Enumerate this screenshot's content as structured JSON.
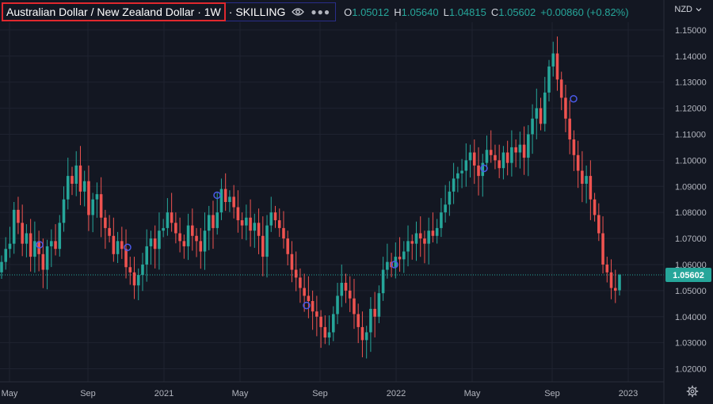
{
  "header": {
    "title": "Australian Dollar / New Zealand Dollar · 1W",
    "broker": "· SKILLING",
    "ohlc": [
      {
        "k": "O",
        "v": "1.05012"
      },
      {
        "k": "H",
        "v": "1.05640"
      },
      {
        "k": "L",
        "v": "1.04815"
      },
      {
        "k": "C",
        "v": "1.05602"
      },
      {
        "k": "",
        "v": "+0.00860 (+0.82%)"
      }
    ],
    "currency": "NZD"
  },
  "colors": {
    "background": "#131722",
    "up": "#26a69a",
    "down": "#ef5350",
    "grid": "#1f2330",
    "text": "#b2b5be",
    "title_border": "#e0282e",
    "price_badge": "#26a69a"
  },
  "chart_data": {
    "type": "candlestick",
    "title": "Australian Dollar / New Zealand Dollar · 1W",
    "ylim": [
      1.015,
      1.153
    ],
    "yticks": [
      "1.15000",
      "1.14000",
      "1.13000",
      "1.12000",
      "1.11000",
      "1.10000",
      "1.09000",
      "1.08000",
      "1.07000",
      "1.06000",
      "1.05000",
      "1.04000",
      "1.03000",
      "1.02000"
    ],
    "xticks": [
      "May",
      "Sep",
      "2021",
      "May",
      "Sep",
      "2022",
      "May",
      "Sep",
      "2023"
    ],
    "last_price": "1.05602",
    "closes": [
      1.061,
      1.066,
      1.068,
      1.081,
      1.076,
      1.068,
      1.072,
      1.063,
      1.069,
      1.064,
      1.058,
      1.067,
      1.069,
      1.066,
      1.076,
      1.085,
      1.094,
      1.091,
      1.098,
      1.088,
      1.092,
      1.079,
      1.085,
      1.087,
      1.078,
      1.074,
      1.071,
      1.064,
      1.069,
      1.066,
      1.059,
      1.057,
      1.052,
      1.056,
      1.06,
      1.067,
      1.07,
      1.066,
      1.073,
      1.074,
      1.08,
      1.076,
      1.072,
      1.069,
      1.067,
      1.075,
      1.071,
      1.069,
      1.065,
      1.073,
      1.079,
      1.074,
      1.08,
      1.089,
      1.084,
      1.086,
      1.082,
      1.077,
      1.075,
      1.078,
      1.073,
      1.076,
      1.071,
      1.063,
      1.075,
      1.08,
      1.077,
      1.074,
      1.07,
      1.064,
      1.058,
      1.055,
      1.051,
      1.048,
      1.046,
      1.042,
      1.04,
      1.036,
      1.032,
      1.034,
      1.041,
      1.048,
      1.053,
      1.05,
      1.047,
      1.041,
      1.036,
      1.031,
      1.034,
      1.043,
      1.04,
      1.049,
      1.058,
      1.061,
      1.059,
      1.063,
      1.062,
      1.065,
      1.069,
      1.068,
      1.072,
      1.07,
      1.068,
      1.073,
      1.071,
      1.074,
      1.08,
      1.083,
      1.088,
      1.093,
      1.095,
      1.096,
      1.1,
      1.103,
      1.098,
      1.094,
      1.099,
      1.104,
      1.102,
      1.1,
      1.097,
      1.103,
      1.099,
      1.105,
      1.103,
      1.106,
      1.101,
      1.11,
      1.116,
      1.12,
      1.114,
      1.126,
      1.136,
      1.141,
      1.131,
      1.124,
      1.116,
      1.108,
      1.102,
      1.096,
      1.091,
      1.094,
      1.085,
      1.079,
      1.072,
      1.06,
      1.057,
      1.051,
      1.05,
      1.056
    ]
  }
}
